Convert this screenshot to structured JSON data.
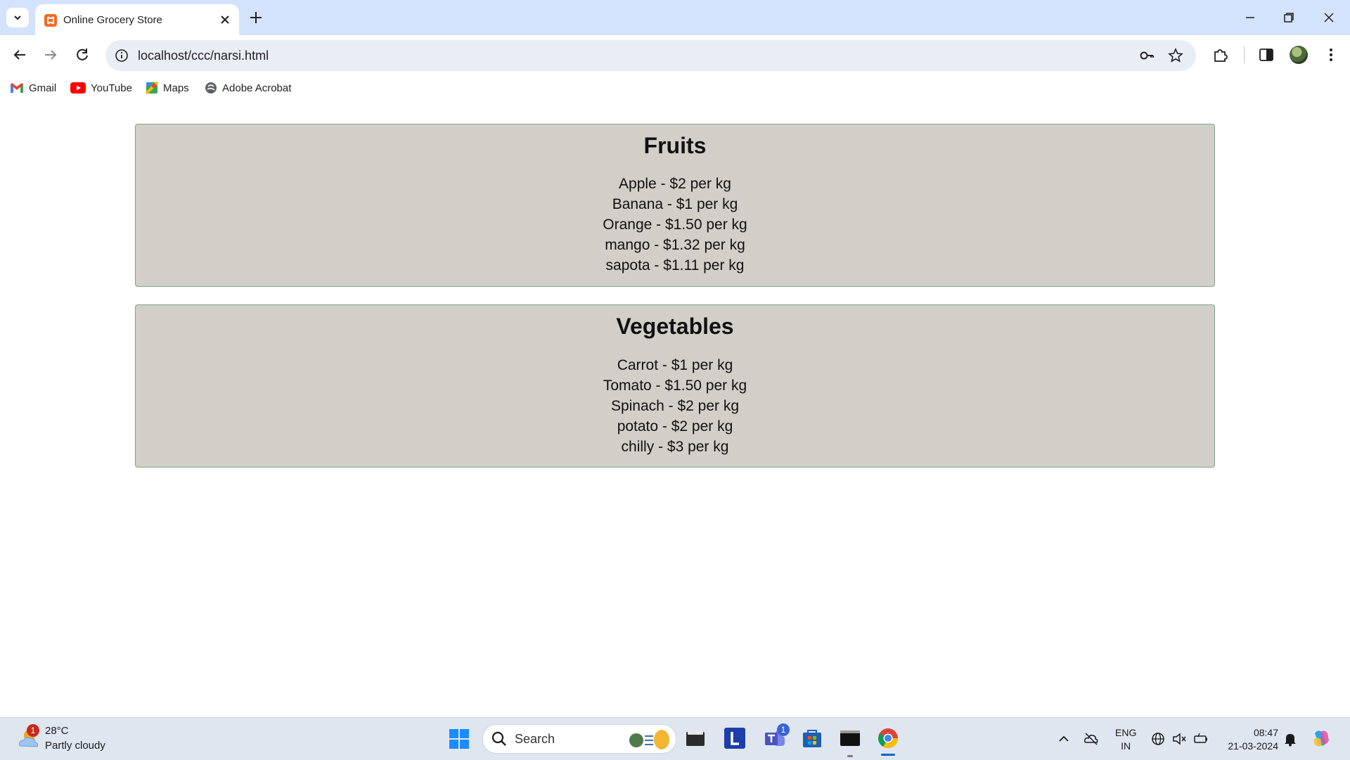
{
  "browser": {
    "tab": {
      "title": "Online Grocery Store"
    },
    "url": "localhost/ccc/narsi.html",
    "bookmarks": [
      {
        "label": "Gmail",
        "icon": "gmail-icon"
      },
      {
        "label": "YouTube",
        "icon": "youtube-icon"
      },
      {
        "label": "Maps",
        "icon": "maps-icon"
      },
      {
        "label": "Adobe Acrobat",
        "icon": "acrobat-icon"
      }
    ]
  },
  "page": {
    "sections": [
      {
        "title": "Fruits",
        "items": [
          "Apple - $2 per kg",
          "Banana - $1 per kg",
          "Orange - $1.50 per kg",
          "mango - $1.32 per kg",
          "sapota - $1.11 per kg"
        ]
      },
      {
        "title": "Vegetables",
        "items": [
          "Carrot - $1 per kg",
          "Tomato - $1.50 per kg",
          "Spinach - $2 per kg",
          "potato - $2 per kg",
          "chilly - $3 per kg"
        ]
      }
    ]
  },
  "taskbar": {
    "weather": {
      "temp": "28°C",
      "desc": "Partly cloudy",
      "badge": "1"
    },
    "search_placeholder": "Search",
    "teams_badge": "1",
    "language": {
      "line1": "ENG",
      "line2": "IN"
    },
    "clock": {
      "time": "08:47",
      "date": "21-03-2024"
    }
  },
  "colors": {
    "titlebar": "#d3e3fd",
    "omnibox": "#e9eef6",
    "section_bg": "#d2cfc8",
    "section_border": "#7fa58a",
    "taskbar": "#dfe6f0"
  }
}
